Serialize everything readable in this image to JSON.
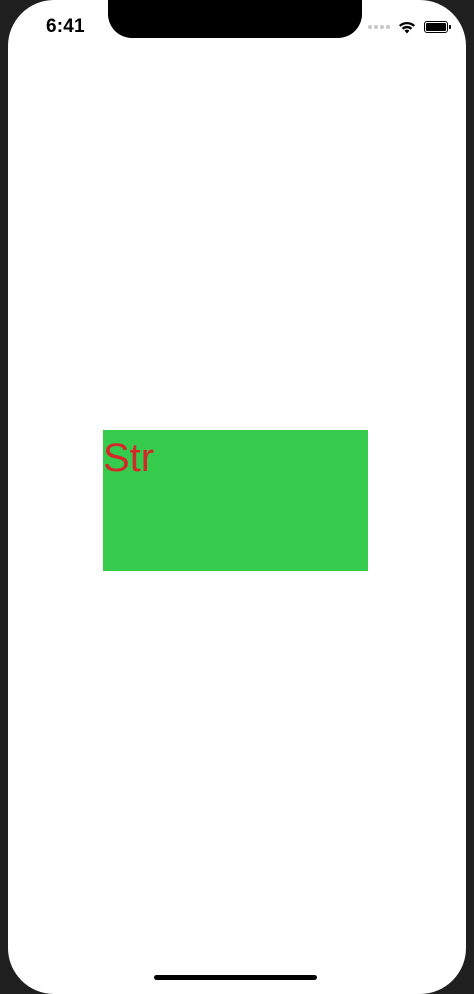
{
  "status_bar": {
    "time": "6:41",
    "signal_icon": "signal-dots-icon",
    "wifi_icon": "wifi-icon",
    "battery_icon": "battery-full-icon"
  },
  "content": {
    "label_text": "Str",
    "label_color": "#d7262a",
    "view_color": "#35cc4e"
  }
}
